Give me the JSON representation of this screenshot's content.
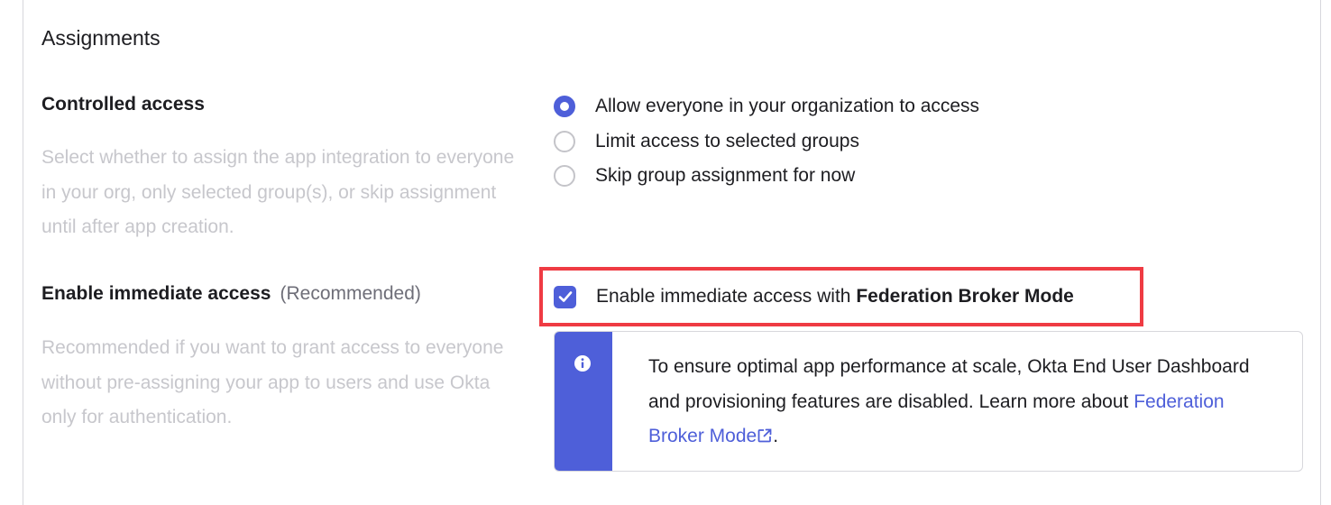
{
  "section": {
    "title": "Assignments"
  },
  "controlled_access": {
    "label": "Controlled access",
    "help": "Select whether to assign the app integration to everyone in your org, only selected group(s), or skip assignment until after app creation.",
    "options": [
      {
        "label": "Allow everyone in your organization to access",
        "selected": true
      },
      {
        "label": "Limit access to selected groups",
        "selected": false
      },
      {
        "label": "Skip group assignment for now",
        "selected": false
      }
    ]
  },
  "immediate_access": {
    "label": "Enable immediate access",
    "label_suffix": "(Recommended)",
    "help": "Recommended if you want to grant access to everyone without pre-assigning your app to users and use Okta only for authentication.",
    "checkbox_text": "Enable immediate access with ",
    "checkbox_bold": "Federation Broker Mode",
    "checked": true
  },
  "callout": {
    "icon": "info-icon",
    "text": "To ensure optimal app performance at scale, Okta End User Dashboard and provisioning features are disabled. Learn more about ",
    "link_text": "Federation Broker Mode",
    "link_icon": "external-link-icon",
    "trailing": "."
  },
  "colors": {
    "accent": "#4e5fd9",
    "highlight": "#ef3b43",
    "muted_text": "#c7c7cc"
  }
}
